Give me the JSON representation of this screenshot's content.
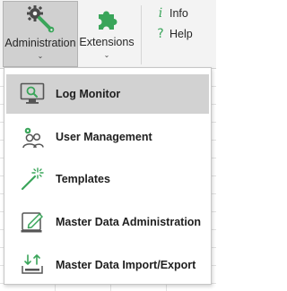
{
  "ribbon": {
    "administration": {
      "label": "Administration",
      "icon": "wrench-gear-icon",
      "active": true
    },
    "extensions": {
      "label": "Extensions",
      "icon": "puzzle-piece-icon"
    },
    "info": {
      "label": "Info",
      "icon": "info-icon"
    },
    "help": {
      "label": "Help",
      "icon": "question-icon"
    }
  },
  "menu": {
    "items": [
      {
        "label": "Log Monitor",
        "icon": "monitor-search-icon",
        "selected": true
      },
      {
        "label": "User Management",
        "icon": "users-gear-icon"
      },
      {
        "label": "Templates",
        "icon": "magic-wand-icon"
      },
      {
        "label": "Master Data Administration",
        "icon": "edit-document-icon"
      },
      {
        "label": "Master Data Import/Export",
        "icon": "import-export-icon"
      }
    ]
  },
  "colors": {
    "accent_green": "#3aa55a",
    "selection_gray": "#d2d2d2",
    "ribbon_bg": "#f3f3f3"
  }
}
